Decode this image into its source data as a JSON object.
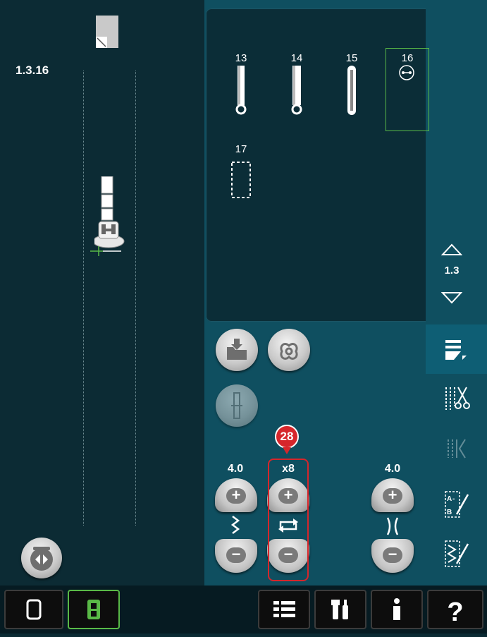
{
  "preview": {
    "sequence_label": "1.3.16"
  },
  "stitches": [
    {
      "num": "13"
    },
    {
      "num": "14"
    },
    {
      "num": "15"
    },
    {
      "num": "16",
      "selected": true
    },
    {
      "num": "17"
    }
  ],
  "scroll": {
    "menu_label": "1.3"
  },
  "controls": {
    "width_value": "4.0",
    "repeat_value": "x8",
    "length_value": "4.0"
  },
  "callout": {
    "number": "28"
  },
  "colors": {
    "accent_green": "#59b947",
    "callout_red": "#d6262b",
    "panel_blue": "#0f4f60"
  },
  "icons": {
    "taskbar": [
      "window-icon",
      "embroidery-mode-icon",
      "menu-list-icon",
      "tools-icon",
      "info-icon",
      "help-icon"
    ],
    "sidebar": [
      "stitch-menu-icon",
      "thread-cut-icon",
      "tapering-icon",
      "sequence-icon",
      "stitch-programming-icon"
    ]
  }
}
